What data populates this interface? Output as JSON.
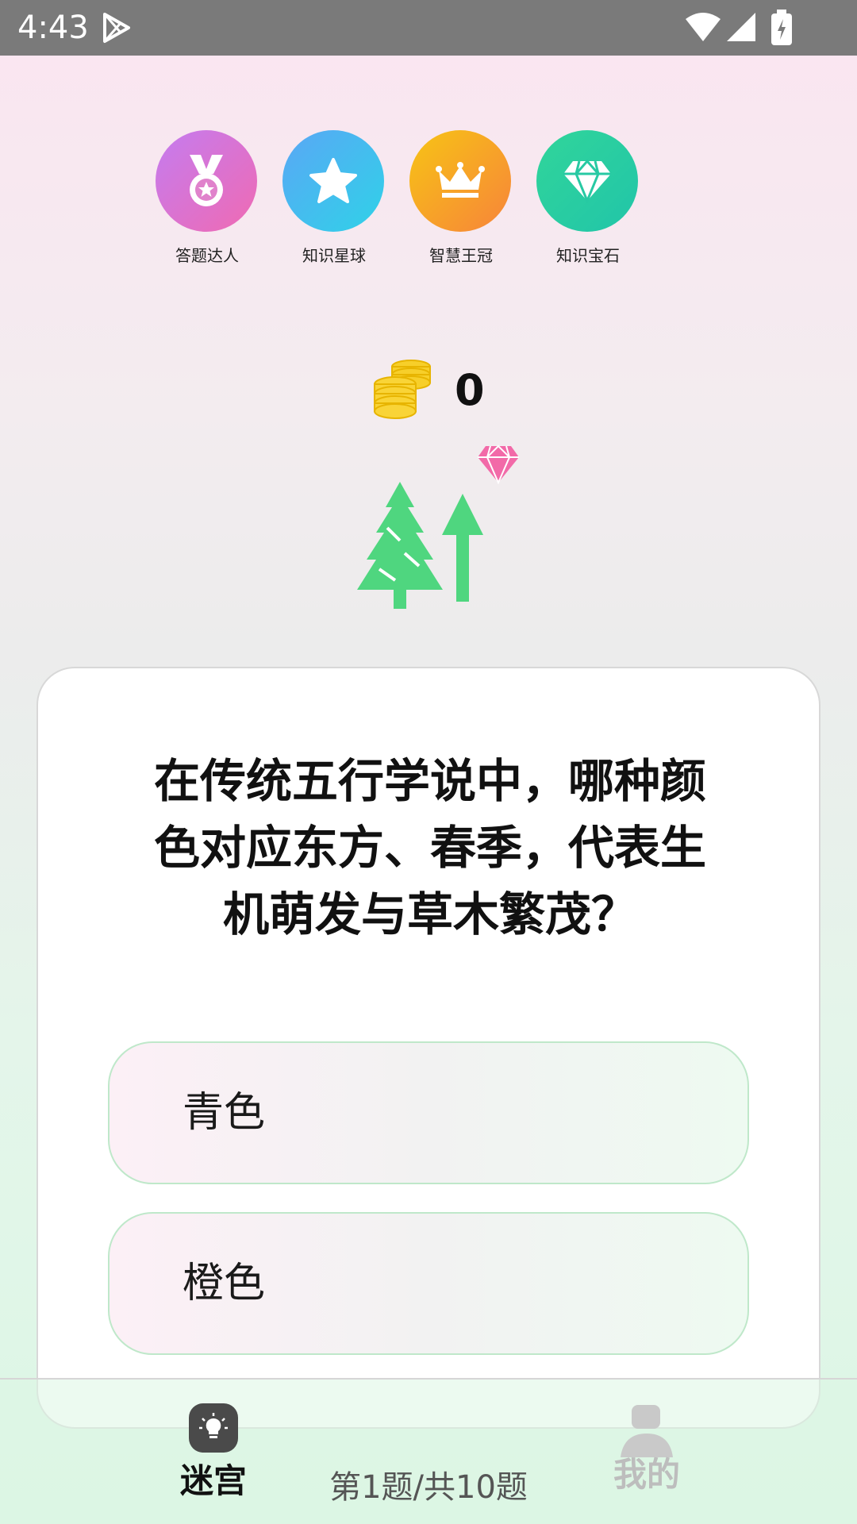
{
  "status_bar": {
    "time": "4:43",
    "icons": [
      "play-store-icon",
      "wifi-icon",
      "cell-signal-icon",
      "battery-icon"
    ]
  },
  "badges": [
    {
      "label": "答题达人",
      "icon": "medal-icon",
      "color_from": "#c47cf0",
      "color_to": "#f06ab2"
    },
    {
      "label": "知识星球",
      "icon": "star-icon",
      "color_from": "#5aa7f5",
      "color_to": "#2fd2e8"
    },
    {
      "label": "智慧王冠",
      "icon": "crown-icon",
      "color_from": "#f7c415",
      "color_to": "#f7843a"
    },
    {
      "label": "知识宝石",
      "icon": "diamond-icon",
      "color_from": "#31d59a",
      "color_to": "#21c5a9"
    }
  ],
  "coins": {
    "count": "0",
    "icon": "coin-stack-icon"
  },
  "scene": {
    "icons": [
      "pink-gem-icon",
      "pine-tree-icon",
      "up-arrow-icon"
    ],
    "tree_color": "#4fd67f",
    "gem_color": "#f26aa8"
  },
  "quiz": {
    "question": "在传统五行学说中，哪种颜色对应东方、春季，代表生机萌发与草木繁茂？",
    "options": [
      {
        "label": "青色"
      },
      {
        "label": "橙色"
      }
    ],
    "progress": "第1题/共10题"
  },
  "nav": {
    "tabs": [
      {
        "label": "迷宫",
        "icon": "lightbulb-icon",
        "active": true
      },
      {
        "label": "我的",
        "icon": "user-icon",
        "active": false
      }
    ]
  }
}
